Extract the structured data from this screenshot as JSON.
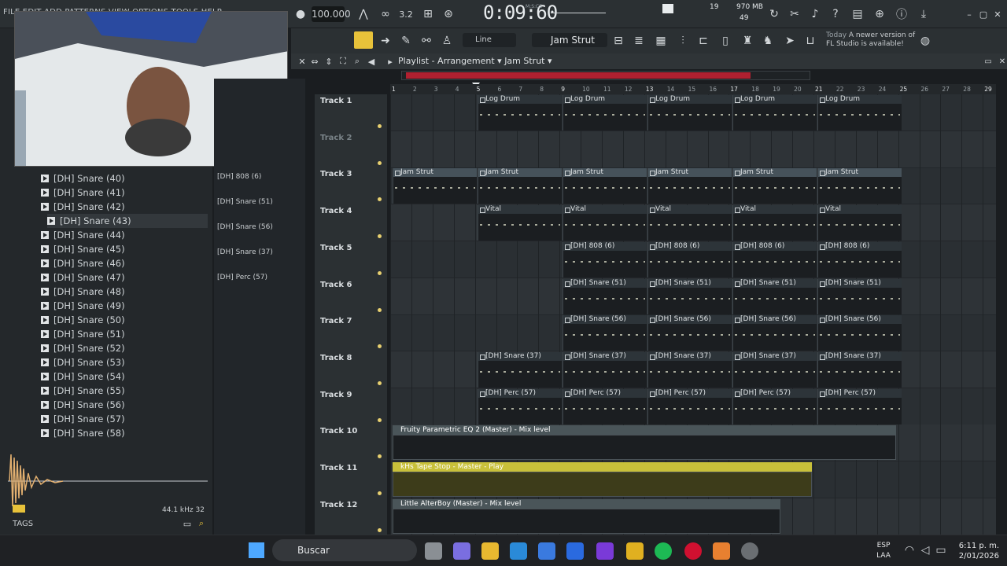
{
  "menu": [
    "FILE",
    "EDIT",
    "ADD",
    "PATTERNS",
    "VIEW",
    "OPTIONS",
    "TOOLS",
    "HELP"
  ],
  "transport": {
    "tempo": "100.000",
    "pattern_num": "3.2",
    "time": "0:09:60",
    "time_unit": "M:S:CS"
  },
  "cpu": {
    "ram": "970 MB",
    "voices": "19",
    "polyphony": "49"
  },
  "toolbar2": {
    "snap": "Line",
    "pattern": "Jam Strut",
    "news_date": "Today",
    "news_text": "A newer version of FL Studio is available!"
  },
  "playlist": {
    "title": "Playlist - Arrangement",
    "pattern": "Jam Strut"
  },
  "browser_items": [
    "[DH] Snare (40)",
    "[DH] Snare (41)",
    "[DH] Snare (42)",
    "[DH] Snare (43)",
    "[DH] Snare (44)",
    "[DH] Snare (45)",
    "[DH] Snare (46)",
    "[DH] Snare (47)",
    "[DH] Snare (48)",
    "[DH] Snare (49)",
    "[DH] Snare (50)",
    "[DH] Snare (51)",
    "[DH] Snare (52)",
    "[DH] Snare (53)",
    "[DH] Snare (54)",
    "[DH] Snare (55)",
    "[DH] Snare (56)",
    "[DH] Snare (57)",
    "[DH] Snare (58)"
  ],
  "browser_selected": "[DH] Snare (43)",
  "sample_rate": "44.1 kHz 32",
  "tags_label": "TAGS",
  "picker": [
    "[DH] 808 (6)",
    "[DH] Snare (51)",
    "[DH] Snare (56)",
    "[DH] Snare (37)",
    "[DH] Perc (57)"
  ],
  "tracks": [
    "Track 1",
    "Track 2",
    "Track 3",
    "Track 4",
    "Track 5",
    "Track 6",
    "Track 7",
    "Track 8",
    "Track 9",
    "Track 10",
    "Track 11",
    "Track 12"
  ],
  "ruler": [
    "1",
    "2",
    "3",
    "4",
    "5",
    "6",
    "7",
    "8",
    "9",
    "10",
    "11",
    "12",
    "13",
    "14",
    "15",
    "16",
    "17",
    "18",
    "19",
    "20",
    "21",
    "22",
    "23",
    "24",
    "25",
    "26",
    "27",
    "28",
    "29"
  ],
  "clips": {
    "t1": "Log Drum",
    "t3": "Jam Strut",
    "t4": "Vital",
    "t5": "[DH] 808 (6)",
    "t6": "[DH] Snare (51)",
    "t7": "[DH] Snare (56)",
    "t8": "[DH] Snare (37)",
    "t9": "[DH] Perc (57)"
  },
  "automation": {
    "t10": "Fruity Parametric EQ 2 (Master) - Mix level",
    "t11": "kHs Tape Stop - Master - Play",
    "t12": "Little AlterBoy (Master) - Mix level"
  },
  "taskbar": {
    "search": "Buscar",
    "lang1": "ESP",
    "lang2": "LAA",
    "time": "6:11 p. m.",
    "date": "2/01/2026"
  },
  "colors": {
    "accent_yellow": "#e8c23a",
    "scroll_red": "#b02030",
    "auto_yellow": "#c8c03a"
  }
}
